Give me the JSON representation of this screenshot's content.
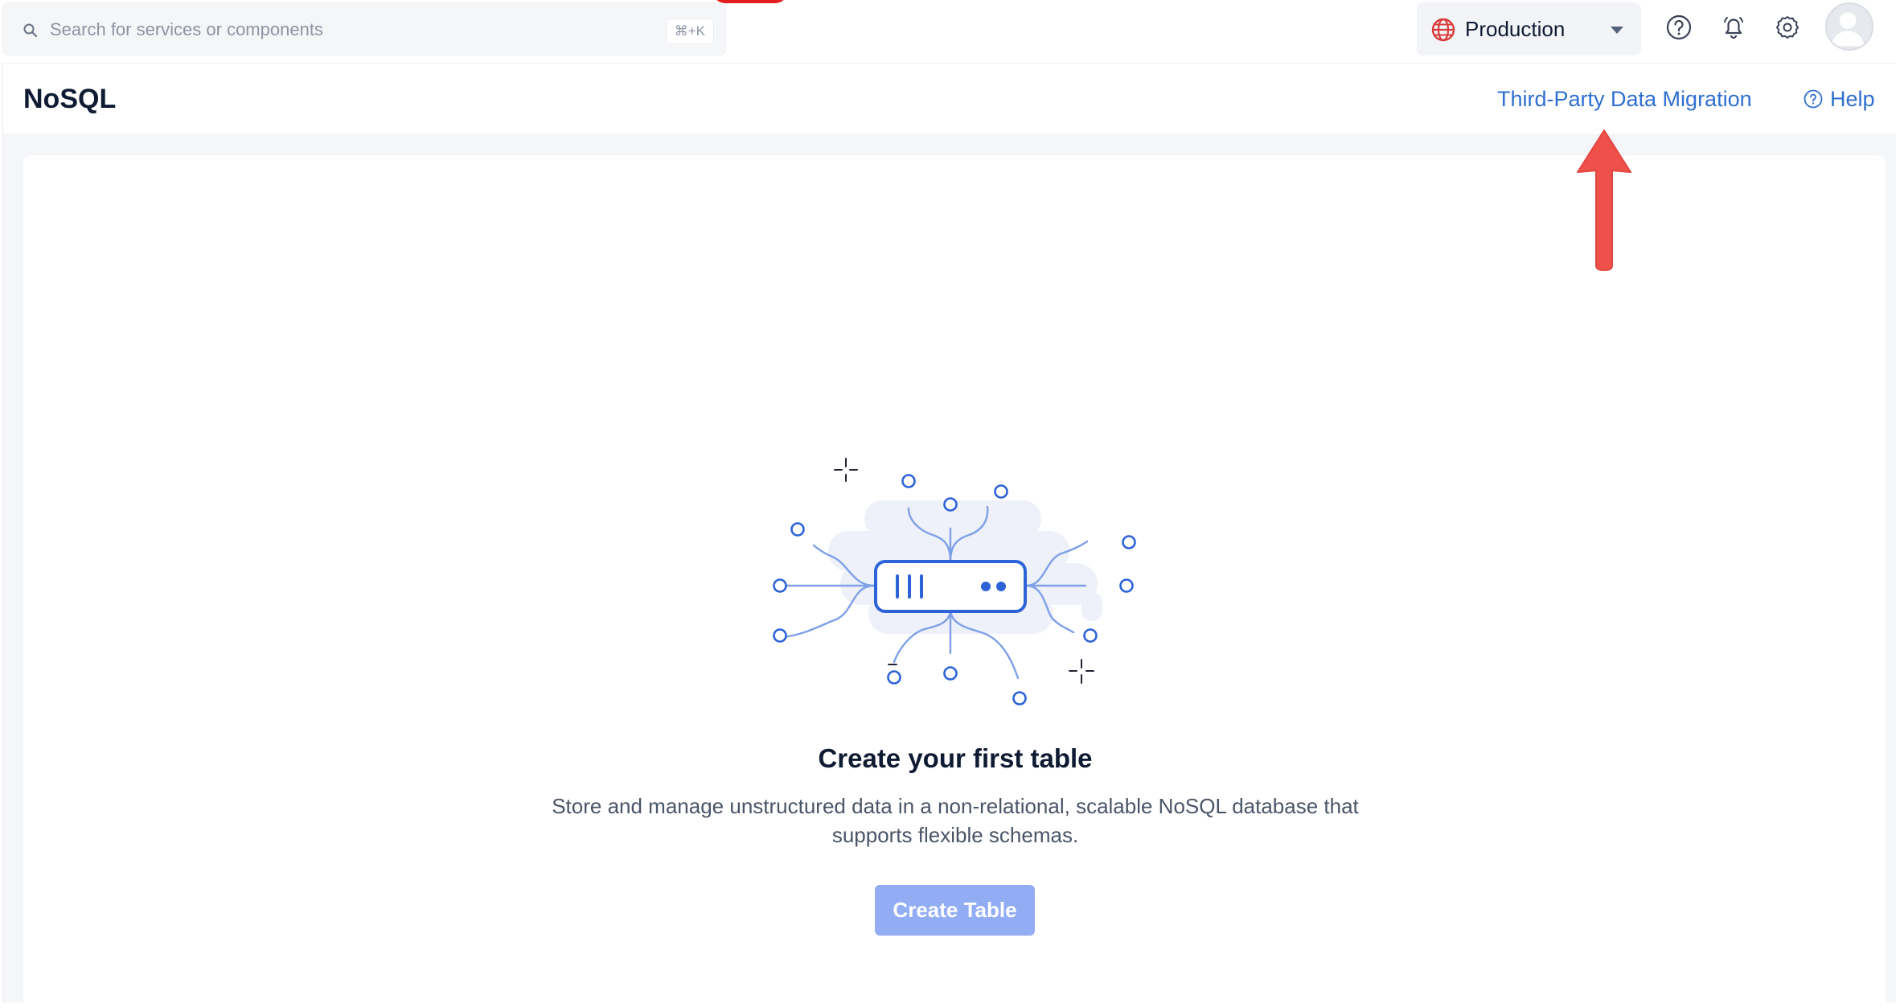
{
  "search": {
    "placeholder": "Search for services or components",
    "shortcut": "⌘+K"
  },
  "environment": {
    "label": "Production",
    "icon": "globe-icon"
  },
  "topbar_icons": [
    "help-circle-icon",
    "bell-icon",
    "gear-icon",
    "avatar"
  ],
  "page": {
    "title": "NoSQL",
    "migration_link": "Third-Party Data Migration",
    "help_link": "Help"
  },
  "empty_state": {
    "title": "Create your first table",
    "description": "Store and manage unstructured data in a non-relational, scalable NoSQL database that supports flexible schemas.",
    "button_label": "Create Table"
  },
  "colors": {
    "accent": "#2f6fd1",
    "button_disabled": "#93adf5",
    "annotation_arrow": "#f0504a"
  }
}
